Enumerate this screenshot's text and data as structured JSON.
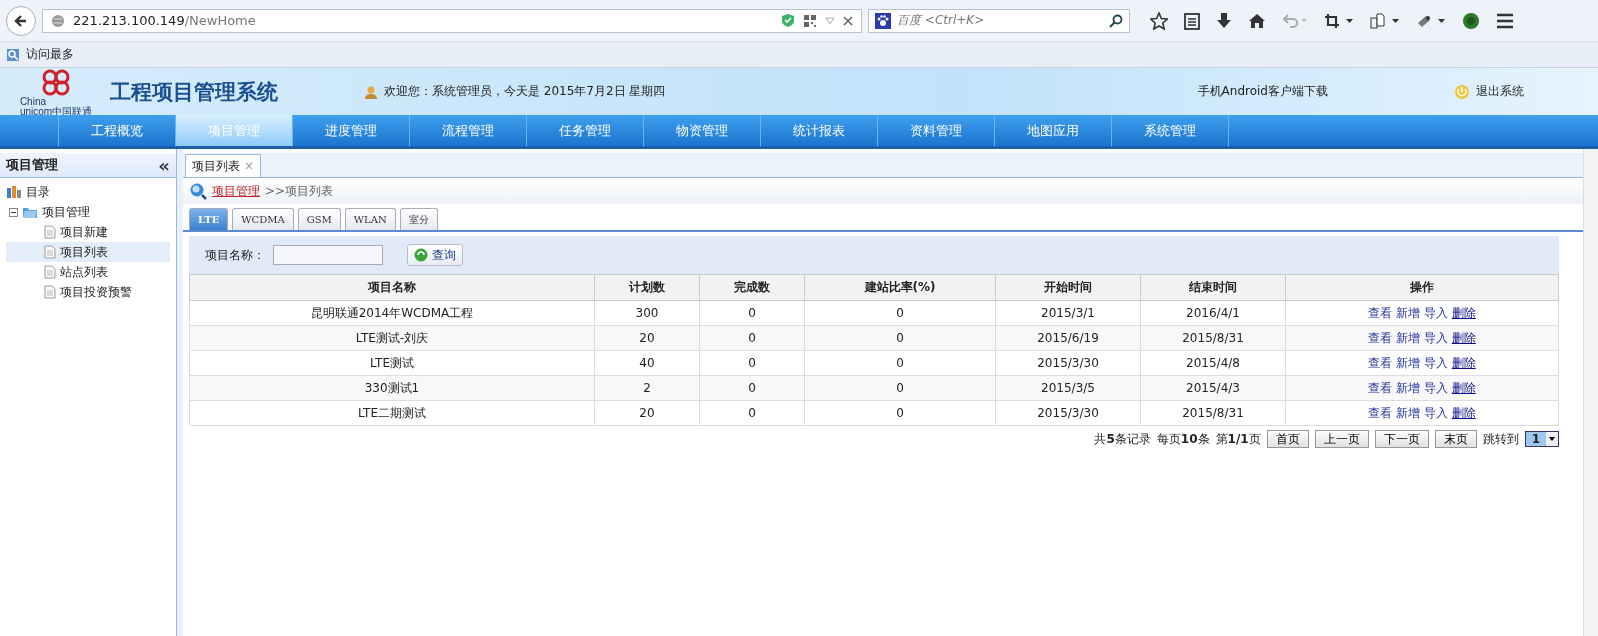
{
  "browser": {
    "url_host": "221.213.100.149",
    "url_path": "/NewHome",
    "search_engine": "百度",
    "search_placeholder": "<Ctrl+K>",
    "bookmark": "访问最多"
  },
  "header": {
    "logo_lines": [
      "China",
      "unicom",
      "中国联通"
    ],
    "title": "工程项目管理系统",
    "welcome": "欢迎您：系统管理员，今天是 2015年7月2日 星期四",
    "android": "手机Android客户端下载",
    "logout": "退出系统"
  },
  "nav": [
    {
      "label": "工程概览",
      "selected": false
    },
    {
      "label": "项目管理",
      "selected": true
    },
    {
      "label": "进度管理",
      "selected": false
    },
    {
      "label": "流程管理",
      "selected": false
    },
    {
      "label": "任务管理",
      "selected": false
    },
    {
      "label": "物资管理",
      "selected": false
    },
    {
      "label": "统计报表",
      "selected": false
    },
    {
      "label": "资料管理",
      "selected": false
    },
    {
      "label": "地图应用",
      "selected": false
    },
    {
      "label": "系统管理",
      "selected": false
    }
  ],
  "sidebar": {
    "title": "项目管理",
    "collapse": "«",
    "tree": [
      {
        "label": "目录",
        "children": [
          {
            "label": "项目管理",
            "expanded": true,
            "children": [
              {
                "label": "项目新建",
                "selected": false
              },
              {
                "label": "项目列表",
                "selected": true
              },
              {
                "label": "站点列表",
                "selected": false
              },
              {
                "label": "项目投资预警",
                "selected": false
              }
            ]
          }
        ]
      }
    ]
  },
  "page_tabs": [
    {
      "label": "项目列表",
      "close": "×",
      "selected": true
    }
  ],
  "breadcrumb": {
    "link": "项目管理",
    "rest": ">>项目列表"
  },
  "type_tabs": [
    {
      "label": "LTE",
      "selected": true
    },
    {
      "label": "WCDMA",
      "selected": false
    },
    {
      "label": "GSM",
      "selected": false
    },
    {
      "label": "WLAN",
      "selected": false
    },
    {
      "label": "室分",
      "selected": false
    }
  ],
  "search": {
    "label": "项目名称：",
    "button": "查询"
  },
  "table": {
    "columns": [
      "项目名称",
      "计划数",
      "完成数",
      "建站比率(%)",
      "开始时间",
      "结束时间",
      "操作"
    ],
    "rows": [
      {
        "cells": [
          "昆明联通2014年WCDMA工程",
          "300",
          "0",
          "0",
          "2015/3/1",
          "2016/4/1"
        ],
        "actions": [
          "查看",
          "新增",
          "导入",
          "删除"
        ]
      },
      {
        "cells": [
          "LTE测试-刘庆",
          "20",
          "0",
          "0",
          "2015/6/19",
          "2015/8/31"
        ],
        "actions": [
          "查看",
          "新增",
          "导入",
          "删除"
        ]
      },
      {
        "cells": [
          "LTE测试",
          "40",
          "0",
          "0",
          "2015/3/30",
          "2015/4/8"
        ],
        "actions": [
          "查看",
          "新增",
          "导入",
          "删除"
        ]
      },
      {
        "cells": [
          "330测试1",
          "2",
          "0",
          "0",
          "2015/3/5",
          "2015/4/3"
        ],
        "actions": [
          "查看",
          "新增",
          "导入",
          "删除"
        ]
      },
      {
        "cells": [
          "LTE二期测试",
          "20",
          "0",
          "0",
          "2015/3/30",
          "2015/8/31"
        ],
        "actions": [
          "查看",
          "新增",
          "导入",
          "删除"
        ]
      }
    ]
  },
  "pagination": {
    "total": "共**5**条记录",
    "per_page": "每页**10**条",
    "page": "第**1/1**页",
    "buttons": [
      "首页",
      "上一页",
      "下一页",
      "末页"
    ],
    "jump_label": "跳转到",
    "jump_value": "1"
  }
}
